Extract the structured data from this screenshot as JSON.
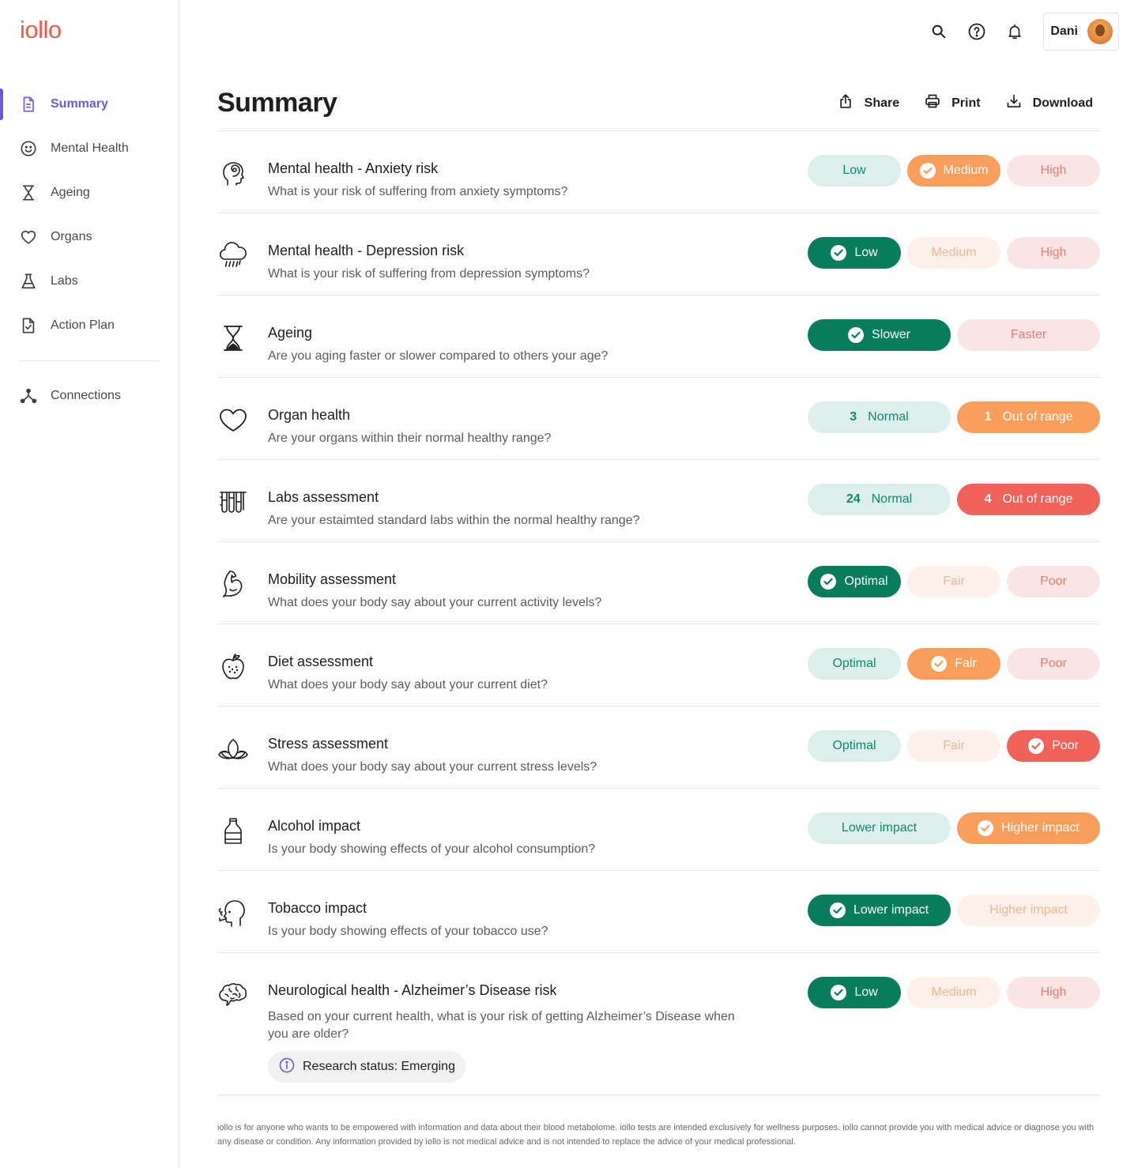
{
  "app": {
    "logo": "iollo"
  },
  "sidebar": {
    "items": [
      {
        "label": "Summary",
        "icon": "document-icon",
        "active": true
      },
      {
        "label": "Mental Health",
        "icon": "smiley-icon"
      },
      {
        "label": "Ageing",
        "icon": "hourglass-icon"
      },
      {
        "label": "Organs",
        "icon": "heart-icon"
      },
      {
        "label": "Labs",
        "icon": "flask-icon"
      },
      {
        "label": "Action Plan",
        "icon": "checklist-icon"
      }
    ],
    "secondary": [
      {
        "label": "Connections",
        "icon": "network-icon"
      }
    ]
  },
  "topbar": {
    "user_name": "Dani",
    "icons": [
      "search-icon",
      "help-icon",
      "bell-icon"
    ]
  },
  "header": {
    "title": "Summary",
    "share_label": "Share",
    "print_label": "Print",
    "download_label": "Download"
  },
  "rows": [
    {
      "title": "Mental health - Anxiety risk",
      "subtitle": "What is your risk of suffering from anxiety symptoms?",
      "icon": "head-spiral-icon",
      "pills": [
        {
          "label": "Low",
          "style": "green-soft"
        },
        {
          "label": "Medium",
          "style": "orange",
          "selected": true
        },
        {
          "label": "High",
          "style": "red-soft"
        }
      ]
    },
    {
      "title": "Mental health - Depression risk",
      "subtitle": "What is your risk of suffering from depression symptoms?",
      "icon": "rain-cloud-icon",
      "pills": [
        {
          "label": "Low",
          "style": "green",
          "selected": true
        },
        {
          "label": "Medium",
          "style": "orange-soft"
        },
        {
          "label": "High",
          "style": "red-soft"
        }
      ]
    },
    {
      "title": "Ageing",
      "subtitle": "Are you aging faster or slower compared to others your age?",
      "icon": "hourglass-icon",
      "pills": [
        {
          "label": "Slower",
          "style": "green",
          "selected": true,
          "wide": true
        },
        {
          "label": "Faster",
          "style": "red-soft",
          "wide": true
        }
      ]
    },
    {
      "title": "Organ health",
      "subtitle": "Are your organs within their normal healthy range?",
      "icon": "heart-icon",
      "pills": [
        {
          "count": "3",
          "label": "Normal",
          "style": "green-soft",
          "wide": true
        },
        {
          "count": "1",
          "label": "Out of range",
          "style": "orange",
          "wide": true
        }
      ]
    },
    {
      "title": "Labs assessment",
      "subtitle": "Are your estaimted standard labs within the normal healthy range?",
      "icon": "test-tubes-icon",
      "pills": [
        {
          "count": "24",
          "label": "Normal",
          "style": "green-soft",
          "wide": true
        },
        {
          "count": "4",
          "label": "Out of range",
          "style": "red",
          "wide": true
        }
      ]
    },
    {
      "title": "Mobility assessment",
      "subtitle": "What does your body say about your current activity levels?",
      "icon": "flexed-arm-icon",
      "pills": [
        {
          "label": "Optimal",
          "style": "green",
          "selected": true
        },
        {
          "label": "Fair",
          "style": "orange-soft"
        },
        {
          "label": "Poor",
          "style": "red-soft"
        }
      ]
    },
    {
      "title": "Diet assessment",
      "subtitle": "What does your body say about your current diet?",
      "icon": "apple-icon",
      "pills": [
        {
          "label": "Optimal",
          "style": "green-soft"
        },
        {
          "label": "Fair",
          "style": "orange",
          "selected": true
        },
        {
          "label": "Poor",
          "style": "red-soft"
        }
      ]
    },
    {
      "title": "Stress assessment",
      "subtitle": "What does your body say about your current stress levels?",
      "icon": "lotus-icon",
      "pills": [
        {
          "label": "Optimal",
          "style": "green-soft"
        },
        {
          "label": "Fair",
          "style": "orange-soft"
        },
        {
          "label": "Poor",
          "style": "red",
          "selected": true
        }
      ]
    },
    {
      "title": "Alcohol impact",
      "subtitle": "Is your body showing effects of your alcohol consumption?",
      "icon": "bottle-icon",
      "pills": [
        {
          "label": "Lower impact",
          "style": "green-soft",
          "wide": true
        },
        {
          "label": "Higher impact",
          "style": "orange",
          "selected": true,
          "wide": true
        }
      ]
    },
    {
      "title": "Tobacco impact",
      "subtitle": "Is your body showing effects of your tobacco use?",
      "icon": "smoking-head-icon",
      "pills": [
        {
          "label": "Lower impact",
          "style": "green",
          "selected": true,
          "wide": true
        },
        {
          "label": "Higher impact",
          "style": "orange-soft",
          "wide": true
        }
      ]
    },
    {
      "title": "Neurological  health - Alzheimer’s Disease risk",
      "subtitle": "Based on your current health, what is your risk of getting Alzheimer’s Disease when you are older?",
      "icon": "brain-icon",
      "research_status": "Research status: Emerging",
      "pills": [
        {
          "label": "Low",
          "style": "green",
          "selected": true
        },
        {
          "label": "Medium",
          "style": "orange-soft"
        },
        {
          "label": "High",
          "style": "red-soft"
        }
      ]
    }
  ],
  "footer": {
    "disclaimer": "iollo is for anyone who wants to be empowered with information and data about their blood metabolome. iollo tests are intended exclusively for wellness purposes. iollo cannot provide you with medical advice or diagnose you with any disease or condition. Any information provided by iollo is not medical advice and is not intended to replace the advice of your medical professional."
  },
  "colors": {
    "brand": "#f05a4b",
    "accent": "#6a5ae0",
    "green": "#077d5d",
    "green_soft": "#dcefeb",
    "orange": "#fa9f5b",
    "orange_soft": "#fdf1ea",
    "red": "#f0625a",
    "red_soft": "#fbe6e6"
  }
}
